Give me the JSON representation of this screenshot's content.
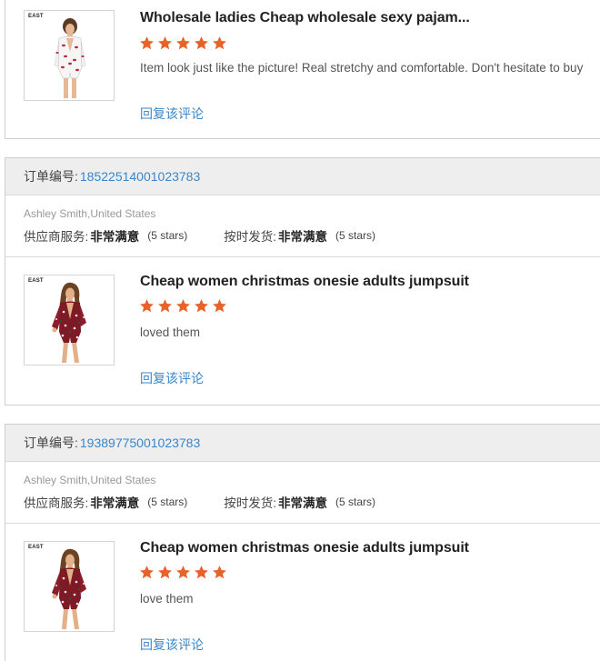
{
  "labels": {
    "order_no": "订单编号:",
    "supplier_service": "供应商服务:",
    "on_time_delivery": "按时发货:",
    "reply": "回复该评论"
  },
  "colors": {
    "star": "#e8632a",
    "link": "#3a86c8",
    "header_bg": "#eeeeee"
  },
  "reviews": [
    {
      "product_title": "Wholesale ladies Cheap wholesale sexy pajam...",
      "rating_stars": 5,
      "comment": "Item look just like the picture! Real stretchy and comfortable. Don't hesitate to buy",
      "thumb_brand": "EAST",
      "thumb_icon": "white-romper-model-image"
    },
    {
      "order_no": "18522514001023783",
      "buyer": "Ashley Smith,United States",
      "supplier_service_value": "非常满意",
      "supplier_service_stars": "(5 stars)",
      "on_time_value": "非常满意",
      "on_time_stars": "(5 stars)",
      "product_title": "Cheap women christmas onesie adults jumpsuit",
      "rating_stars": 5,
      "comment": "loved them",
      "thumb_brand": "EAST",
      "thumb_icon": "red-romper-model-image"
    },
    {
      "order_no": "19389775001023783",
      "buyer": "Ashley Smith,United States",
      "supplier_service_value": "非常满意",
      "supplier_service_stars": "(5 stars)",
      "on_time_value": "非常满意",
      "on_time_stars": "(5 stars)",
      "product_title": "Cheap women christmas onesie adults jumpsuit",
      "rating_stars": 5,
      "comment": "love them",
      "thumb_brand": "EAST",
      "thumb_icon": "red-romper-model-image"
    }
  ]
}
